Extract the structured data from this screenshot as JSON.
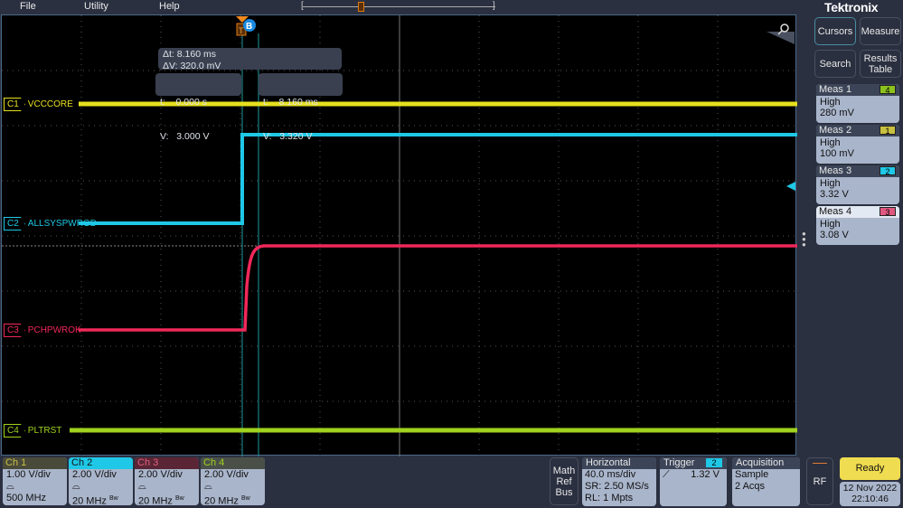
{
  "menu": {
    "items": [
      "File",
      "Utility",
      "Help"
    ]
  },
  "brand": "Tektronix",
  "cursor_readout": {
    "delta_t": "Δt: 8.160 ms",
    "delta_v": "ΔV: 320.0 mV",
    "a_t": "t:    0.000 s",
    "a_v": "V:   3.000 V",
    "b_t": "t:    8.160 ms",
    "b_v": "V:   3.320 V"
  },
  "trigger_marker": {
    "label": "T",
    "cursor": "B"
  },
  "channels_labels": [
    {
      "tag": "C1",
      "name": "VCCCORE",
      "color": "#e6e01e"
    },
    {
      "tag": "C2",
      "name": "ALLSYSPWRGD",
      "color": "#1ec8e6"
    },
    {
      "tag": "C3",
      "name": "PCHPWROK",
      "color": "#f0285a"
    },
    {
      "tag": "C4",
      "name": "PLTRST",
      "color": "#a0d21e"
    }
  ],
  "side": {
    "buttons": [
      "Cursors",
      "Measure",
      "Search",
      "Results Table"
    ],
    "measurements": [
      {
        "title": "Meas 1",
        "source": "4",
        "source_color": "#8cc21e",
        "type": "High",
        "value": "280 mV"
      },
      {
        "title": "Meas 2",
        "source": "1",
        "source_color": "#c8c040",
        "type": "High",
        "value": "100 mV"
      },
      {
        "title": "Meas 3",
        "source": "2",
        "source_color": "#1ec8e6",
        "type": "High",
        "value": "3.32 V"
      },
      {
        "title": "Meas 4",
        "source": "3",
        "source_color": "#e05880",
        "type": "High",
        "value": "3.08 V"
      }
    ]
  },
  "channel_badges": [
    {
      "title": "Ch 1",
      "scale": "1.00 V/div",
      "bw": "500 MHz",
      "bw_limit": "",
      "header_bg": "#4a4a3a",
      "header_fg": "#c8c040"
    },
    {
      "title": "Ch 2",
      "scale": "2.00 V/div",
      "bw": "20 MHz",
      "bw_limit": "Bw",
      "header_bg": "#1ec8e6",
      "header_fg": "#111"
    },
    {
      "title": "Ch 3",
      "scale": "2.00 V/div",
      "bw": "20 MHz",
      "bw_limit": "Bw",
      "header_bg": "#5a2535",
      "header_fg": "#e06080"
    },
    {
      "title": "Ch 4",
      "scale": "2.00 V/div",
      "bw": "20 MHz",
      "bw_limit": "Bw",
      "header_bg": "#4a5048",
      "header_fg": "#a0d21e"
    }
  ],
  "math_ref_bus": [
    "Math",
    "Ref",
    "Bus"
  ],
  "horizontal": {
    "title": "Horizontal",
    "scale": "40.0 ms/div",
    "sr": "SR: 2.50 MS/s",
    "rl": "RL: 1 Mpts"
  },
  "trigger": {
    "title": "Trigger",
    "source": "2",
    "level": "1.32 V",
    "slope": "rising"
  },
  "acquisition": {
    "title": "Acquisition",
    "mode": "Sample",
    "count": "2 Acqs"
  },
  "rf": "RF",
  "status": {
    "state": "Ready",
    "date": "12 Nov 2022",
    "time": "22:10:46"
  }
}
